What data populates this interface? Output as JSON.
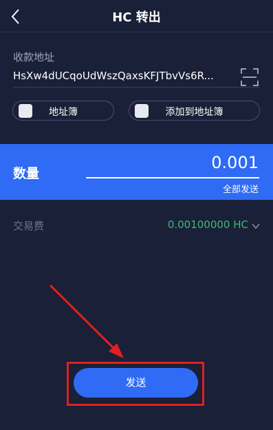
{
  "nav": {
    "title": "HC 转出"
  },
  "address": {
    "label": "收款地址",
    "value": "HsXw4dUCqoUdWszQaxsKFJTbvVs6R..."
  },
  "buttons": {
    "address_book": "地址簿",
    "add_to_address_book": "添加到地址簿"
  },
  "amount": {
    "label": "数量",
    "value": "0.001",
    "send_all": "全部发送"
  },
  "fee": {
    "label": "交易费",
    "value": "0.00100000 HC"
  },
  "send": {
    "label": "发送"
  },
  "colors": {
    "background": "#1a2037",
    "accent": "#2f6bf4",
    "fee_green": "#3fb97a",
    "annotation_red": "#e02020"
  }
}
